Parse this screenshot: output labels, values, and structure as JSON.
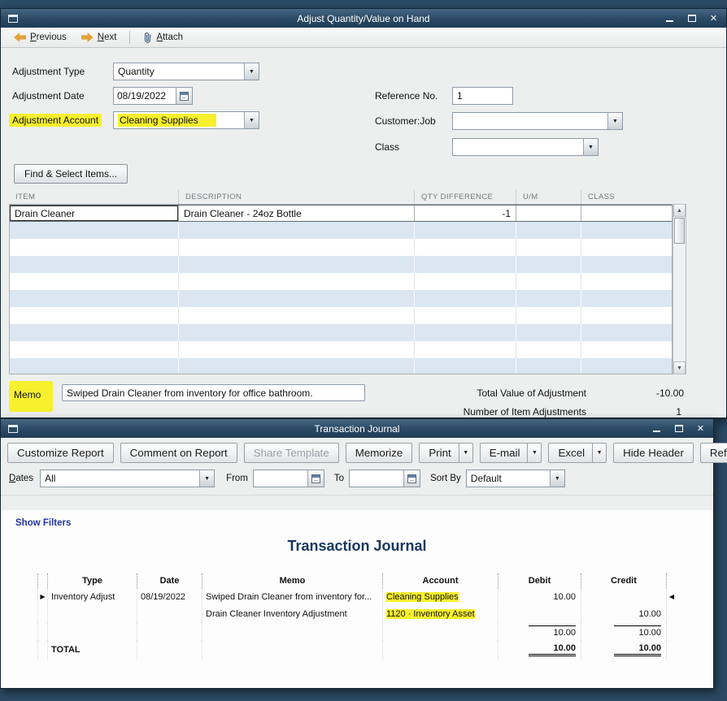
{
  "adjust": {
    "title": "Adjust Quantity/Value on Hand",
    "toolbar": {
      "previous": "Previous",
      "next": "Next",
      "attach": "Attach"
    },
    "form": {
      "type_label": "Adjustment Type",
      "type_value": "Quantity",
      "date_label": "Adjustment Date",
      "date_value": "08/19/2022",
      "account_label": "Adjustment Account",
      "account_value": "Cleaning Supplies",
      "reference_label": "Reference No.",
      "reference_value": "1",
      "customer_label": "Customer:Job",
      "class_label": "Class"
    },
    "find_select_label": "Find & Select Items...",
    "items_table": {
      "headers": [
        "ITEM",
        "DESCRIPTION",
        "QTY DIFFERENCE",
        "U/M",
        "CLASS"
      ],
      "rows": [
        {
          "item": "Drain Cleaner",
          "description": "Drain Cleaner - 24oz Bottle",
          "qty_difference": "-1",
          "um": "",
          "class": ""
        }
      ]
    },
    "memo_label": "Memo",
    "memo_value": "Swiped Drain Cleaner from inventory for office bathroom.",
    "totals": {
      "total_value_label": "Total Value of Adjustment",
      "total_value": "-10.00",
      "item_adjustments_label": "Number of Item Adjustments",
      "item_adjustments": "1"
    }
  },
  "journal": {
    "title": "Transaction Journal",
    "toolbar": {
      "customize": "Customize Report",
      "comment": "Comment on Report",
      "share": "Share Template",
      "memorize": "Memorize",
      "print": "Print",
      "email": "E-mail",
      "excel": "Excel",
      "hide_header": "Hide Header",
      "refresh": "Refresh"
    },
    "filters": {
      "dates_label": "Dates",
      "dates_value": "All",
      "from_label": "From",
      "to_label": "To",
      "sort_by_label": "Sort By",
      "sort_by_value": "Default"
    },
    "show_filters": "Show Filters",
    "report_title": "Transaction Journal",
    "table": {
      "headers": {
        "type": "Type",
        "date": "Date",
        "memo": "Memo",
        "account": "Account",
        "debit": "Debit",
        "credit": "Credit"
      },
      "rows": [
        {
          "type": "Inventory Adjust",
          "date": "08/19/2022",
          "memo": "Swiped Drain Cleaner from inventory for...",
          "account": "Cleaning Supplies",
          "debit": "10.00",
          "credit": ""
        },
        {
          "type": "",
          "date": "",
          "memo": "Drain Cleaner Inventory Adjustment",
          "account": "1120 · Inventory Asset",
          "debit": "",
          "credit": "10.00"
        }
      ],
      "subtotal": {
        "debit": "10.00",
        "credit": "10.00"
      },
      "total_label": "TOTAL",
      "total": {
        "debit": "10.00",
        "credit": "10.00"
      }
    },
    "highlight_color": "#f7f02c"
  }
}
